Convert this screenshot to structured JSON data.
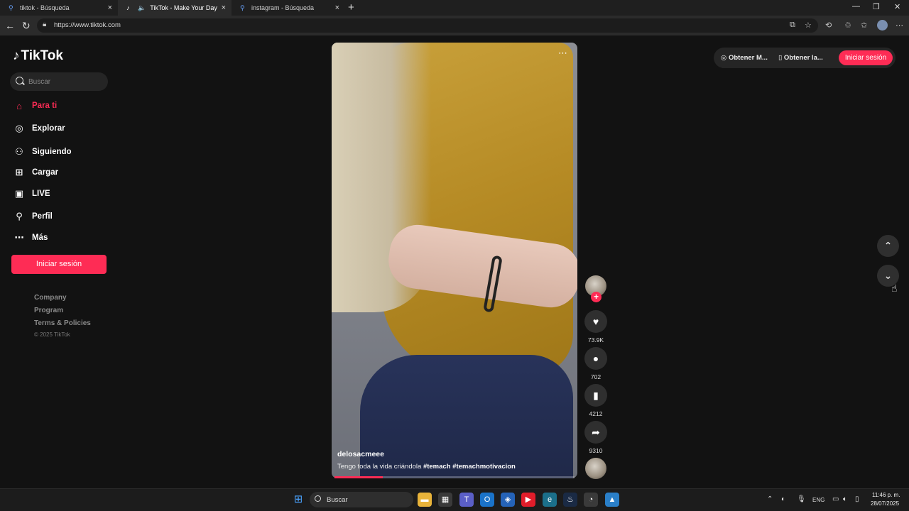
{
  "browser": {
    "tabs": [
      {
        "title": "tiktok - Búsqueda"
      },
      {
        "title": "TikTok - Make Your Day"
      },
      {
        "title": "instagram - Búsqueda"
      }
    ],
    "url": "https://www.tiktok.com"
  },
  "sidebar": {
    "logo": "TikTok",
    "search_placeholder": "Buscar",
    "items": [
      {
        "label": "Para ti"
      },
      {
        "label": "Explorar"
      },
      {
        "label": "Siguiendo"
      },
      {
        "label": "Cargar"
      },
      {
        "label": "LIVE"
      },
      {
        "label": "Perfil"
      },
      {
        "label": "Más"
      }
    ],
    "login_label": "Iniciar sesión",
    "footer_links": [
      "Company",
      "Program",
      "Terms & Policies"
    ],
    "copyright": "© 2025 TikTok"
  },
  "topbar": {
    "get_app_label": "Obtener M...",
    "get_app2_label": "Obtener la...",
    "login_label": "Iniciar sesión"
  },
  "video": {
    "author": "delosacmeee",
    "caption_text": "Tengo toda la vida criándola ",
    "hashtags": [
      "#temach",
      "#temachmotivacion"
    ],
    "progress": 0.2,
    "likes": "73.9K",
    "comments": "702",
    "saves": "4212",
    "shares": "9310"
  },
  "taskbar": {
    "search_label": "Buscar",
    "lang": "ENG",
    "time": "11:46 p. m.",
    "date": "28/07/2025"
  },
  "colors": {
    "accent": "#fe2c55",
    "background": "#121212"
  }
}
